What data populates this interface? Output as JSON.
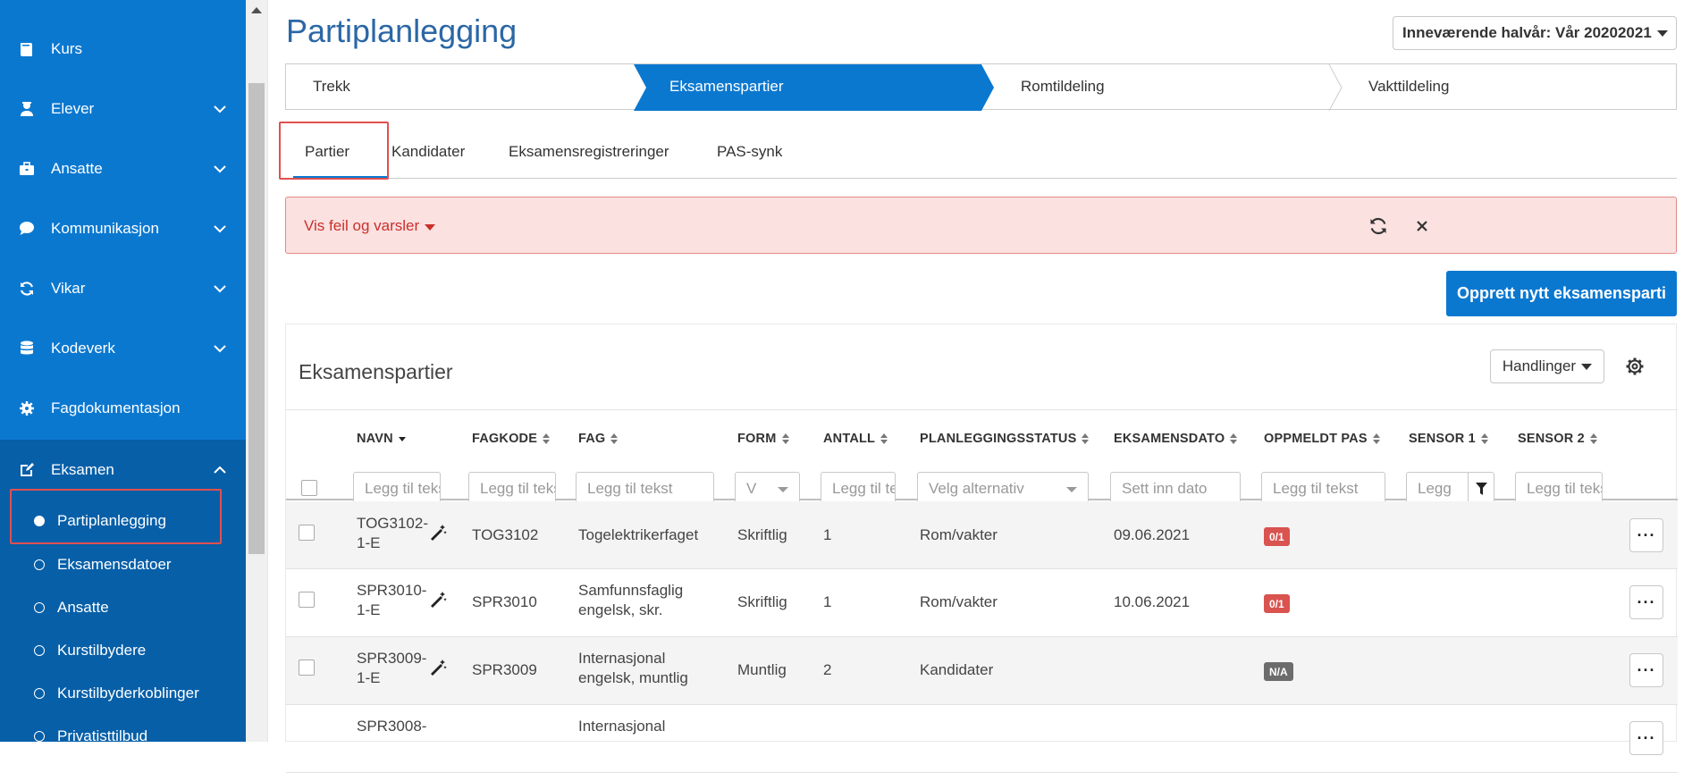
{
  "sidebar": {
    "items": [
      {
        "label": "Kurs",
        "icon": "book-icon"
      },
      {
        "label": "Elever",
        "icon": "students-icon"
      },
      {
        "label": "Ansatte",
        "icon": "briefcase-icon"
      },
      {
        "label": "Kommunikasjon",
        "icon": "chat-icon"
      },
      {
        "label": "Vikar",
        "icon": "refresh-icon"
      },
      {
        "label": "Kodeverk",
        "icon": "database-icon"
      },
      {
        "label": "Fagdokumentasjon",
        "icon": "cog-icon"
      },
      {
        "label": "Eksamen",
        "icon": "edit-icon"
      }
    ],
    "eksamen_sub": [
      "Partiplanlegging",
      "Eksamensdatoer",
      "Ansatte",
      "Kurstilbydere",
      "Kurstilbyderkoblinger",
      "Privatisttilbud"
    ]
  },
  "header": {
    "title": "Partiplanlegging",
    "semester": "Inneværende halvår: Vår 20202021"
  },
  "steps": [
    "Trekk",
    "Eksamenspartier",
    "Romtildeling",
    "Vakttildeling"
  ],
  "tabs": [
    "Partier",
    "Kandidater",
    "Eksamensregistreringer",
    "PAS-synk"
  ],
  "alert": {
    "text": "Vis feil og varsler"
  },
  "create_button": "Opprett nytt eksamensparti",
  "card": {
    "title": "Eksamenspartier",
    "actions": "Handlinger"
  },
  "columns": [
    "NAVN",
    "FAGKODE",
    "FAG",
    "FORM",
    "ANTALL",
    "PLANLEGGINGSSTATUS",
    "EKSAMENSDATO",
    "OPPMELDT PAS",
    "SENSOR 1",
    "SENSOR 2"
  ],
  "filters": {
    "navn": "Legg til tekst",
    "fagkode": "Legg til tekst",
    "fag": "Legg til tekst",
    "form": "V",
    "antall": "Legg til tekst",
    "status": "Velg alternativ",
    "dato": "Sett inn dato",
    "pas": "Legg til tekst",
    "sensor1": "Legg",
    "sensor2": "Legg til tekst"
  },
  "rows": [
    {
      "navn1": "TOG3102-",
      "navn2": "1-E",
      "fagkode": "TOG3102",
      "fag1": "Togelektrikerfaget",
      "fag2": "",
      "form": "Skriftlig",
      "antall": "1",
      "status": "Rom/vakter",
      "dato": "09.06.2021",
      "pas": "0/1"
    },
    {
      "navn1": "SPR3010-",
      "navn2": "1-E",
      "fagkode": "SPR3010",
      "fag1": "Samfunnsfaglig",
      "fag2": "engelsk, skr.",
      "form": "Skriftlig",
      "antall": "1",
      "status": "Rom/vakter",
      "dato": "10.06.2021",
      "pas": "0/1"
    },
    {
      "navn1": "SPR3009-",
      "navn2": "1-E",
      "fagkode": "SPR3009",
      "fag1": "Internasjonal",
      "fag2": "engelsk, muntlig",
      "form": "Muntlig",
      "antall": "2",
      "status": "Kandidater",
      "dato": "",
      "pas": "N/A"
    },
    {
      "navn1": "SPR3008-",
      "navn2": "",
      "fagkode": "",
      "fag1": "Internasjonal",
      "fag2": "",
      "form": "",
      "antall": "",
      "status": "",
      "dato": "",
      "pas": ""
    }
  ],
  "more_button": "···",
  "colors": {
    "primary": "#0b78d0",
    "sidebar_active": "#075fa8",
    "alert_bg": "#fbe1e0",
    "badge_red": "#d9534f",
    "badge_gray": "#6c6c6c"
  }
}
